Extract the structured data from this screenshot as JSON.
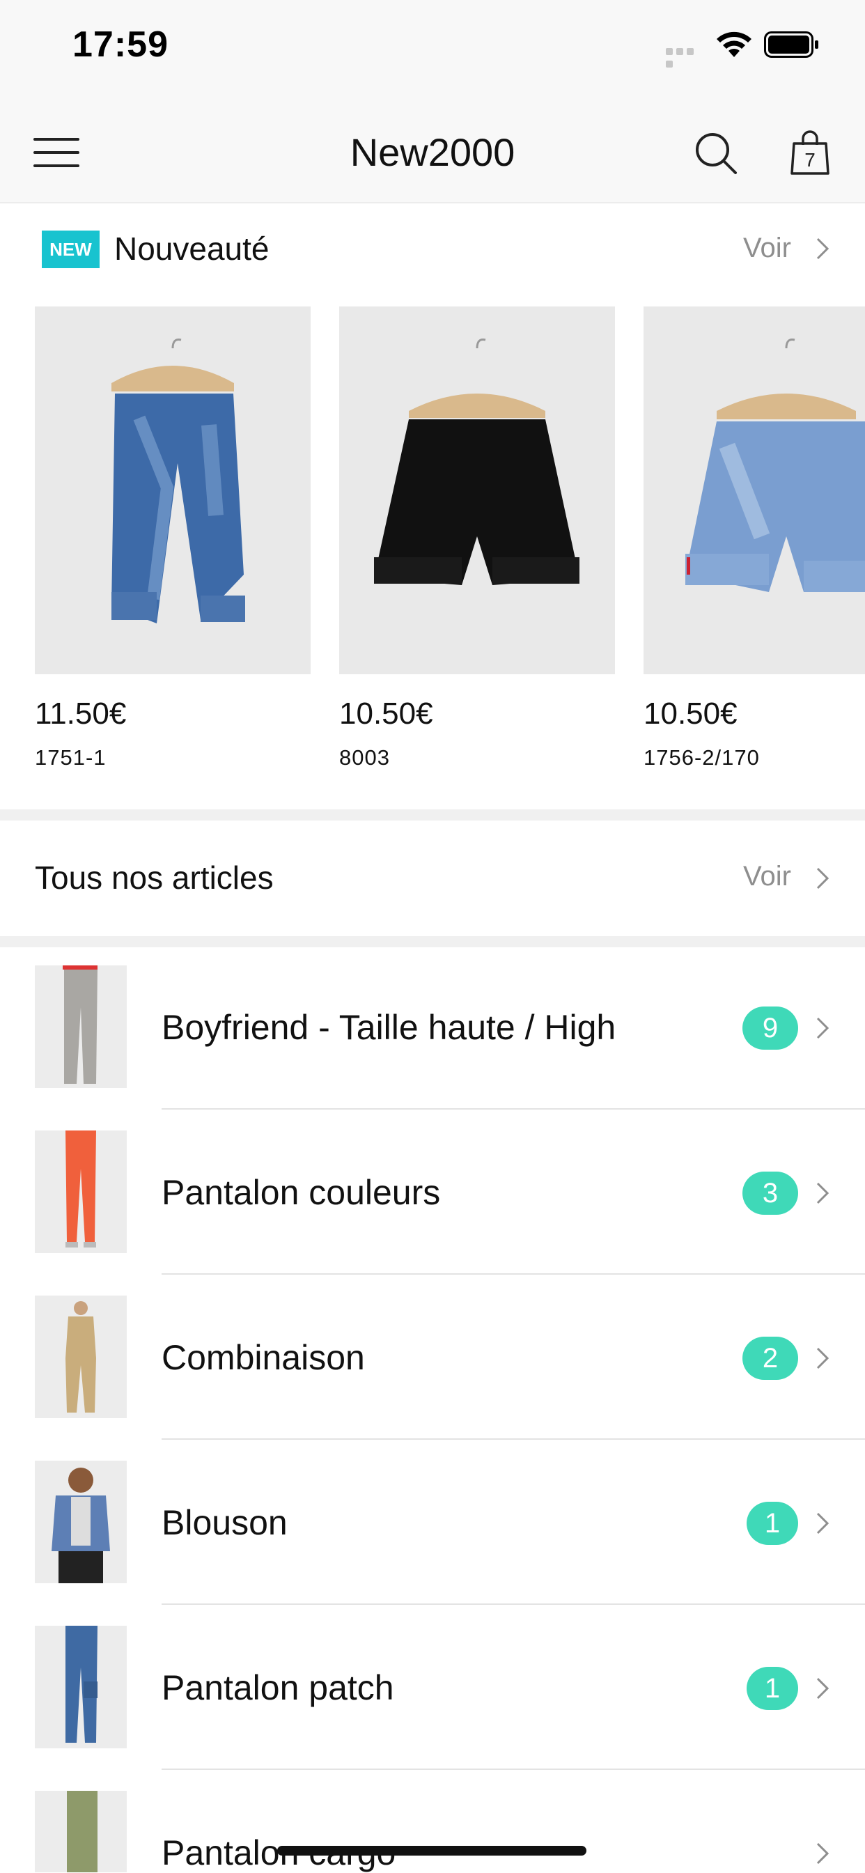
{
  "status_bar": {
    "time": "17:59"
  },
  "nav": {
    "title": "New2000",
    "cart_count": "7"
  },
  "new_section": {
    "badge": "NEW",
    "title": "Nouveauté",
    "see_all": "Voir",
    "products": [
      {
        "price": "11.50€",
        "ref": "1751-1"
      },
      {
        "price": "10.50€",
        "ref": "8003"
      },
      {
        "price": "10.50€",
        "ref": "1756-2/170"
      }
    ]
  },
  "all_section": {
    "title": "Tous nos articles",
    "see_all": "Voir"
  },
  "categories": [
    {
      "label": "Boyfriend - Taille haute / High",
      "count": "9"
    },
    {
      "label": "Pantalon couleurs",
      "count": "3"
    },
    {
      "label": "Combinaison",
      "count": "2"
    },
    {
      "label": "Blouson",
      "count": "1"
    },
    {
      "label": "Pantalon patch",
      "count": "1"
    },
    {
      "label": "Pantalon cargo",
      "count": ""
    }
  ],
  "colors": {
    "new_badge": "#18c3cf",
    "count_badge": "#3fd9b8"
  },
  "icons": [
    "signal-icon",
    "wifi-icon",
    "battery-icon",
    "menu-icon",
    "search-icon",
    "shopping-bag-icon",
    "chevron-right-icon"
  ]
}
